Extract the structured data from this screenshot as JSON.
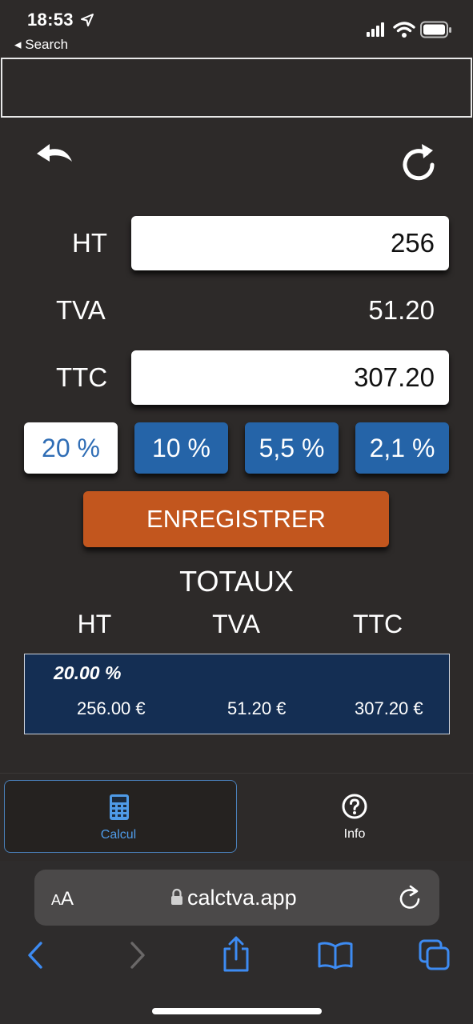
{
  "status_bar": {
    "time": "18:53",
    "back_label": "◂ Search"
  },
  "calculator": {
    "ht_label": "HT",
    "ht_value": "256",
    "tva_label": "TVA",
    "tva_value": "51.20",
    "ttc_label": "TTC",
    "ttc_value": "307.20",
    "rates": [
      {
        "label": "20 %",
        "active": true
      },
      {
        "label": "10 %",
        "active": false
      },
      {
        "label": "5,5 %",
        "active": false
      },
      {
        "label": "2,1 %",
        "active": false
      }
    ],
    "save_label": "ENREGISTRER"
  },
  "totals": {
    "title": "TOTAUX",
    "headers": [
      "HT",
      "TVA",
      "TTC"
    ],
    "rows": [
      {
        "rate": "20.00 %",
        "ht": "256.00 €",
        "tva": "51.20 €",
        "ttc": "307.20 €"
      }
    ]
  },
  "tabs": [
    {
      "label": "Calcul",
      "icon": "calculator-icon",
      "active": true
    },
    {
      "label": "Info",
      "icon": "question-circle-icon",
      "active": false
    }
  ],
  "browser": {
    "aa_label": "AA",
    "url": "calctva.app"
  },
  "colors": {
    "background": "#2d2a29",
    "accent_blue": "#2564a8",
    "save_orange": "#c2561e",
    "totals_bg": "#142e53",
    "ios_link": "#3d8bf2"
  }
}
